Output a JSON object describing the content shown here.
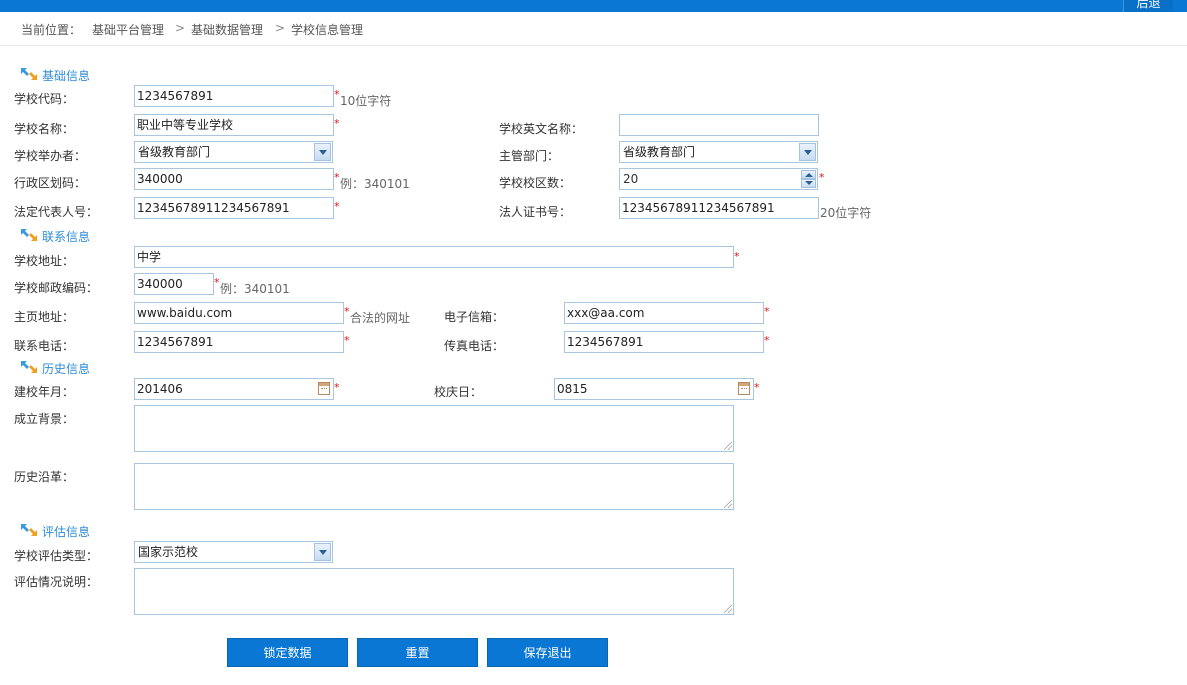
{
  "topbar": {
    "back_label": "后退"
  },
  "breadcrumb": {
    "prefix": "当前位置：",
    "items": [
      "基础平台管理",
      "基础数据管理",
      "学校信息管理"
    ],
    "separator": ">"
  },
  "sections": {
    "basic": "基础信息",
    "contact": "联系信息",
    "history": "历史信息",
    "evaluation": "评估信息"
  },
  "required_mark": "*",
  "basic": {
    "school_code": {
      "label": "学校代码：",
      "value": "1234567891",
      "hint": "10位字符"
    },
    "school_name": {
      "label": "学校名称：",
      "value": "职业中等专业学校"
    },
    "school_name_en": {
      "label": "学校英文名称：",
      "value": ""
    },
    "organizer": {
      "label": "学校举办者：",
      "value": "省级教育部门"
    },
    "department": {
      "label": "主管部门：",
      "value": "省级教育部门"
    },
    "region_code": {
      "label": "行政区划码：",
      "value": "340000",
      "hint": "例：340101"
    },
    "campus_count": {
      "label": "学校校区数：",
      "value": "20"
    },
    "legal_rep_id": {
      "label": "法定代表人号：",
      "value": "12345678911234567891"
    },
    "legal_cert_no": {
      "label": "法人证书号：",
      "value": "12345678911234567891",
      "hint": "20位字符"
    }
  },
  "contact": {
    "address": {
      "label": "学校地址：",
      "value": "中学"
    },
    "postcode": {
      "label": "学校邮政编码：",
      "value": "340000",
      "hint": "例：340101"
    },
    "homepage": {
      "label": "主页地址：",
      "value": "www.baidu.com",
      "hint": "合法的网址"
    },
    "email": {
      "label": "电子信箱：",
      "value": "xxx@aa.com"
    },
    "phone": {
      "label": "联系电话：",
      "value": "1234567891"
    },
    "fax": {
      "label": "传真电话：",
      "value": "1234567891"
    }
  },
  "history": {
    "founded": {
      "label": "建校年月：",
      "value": "201406"
    },
    "anniversary": {
      "label": "校庆日：",
      "value": "0815"
    },
    "background": {
      "label": "成立背景：",
      "value": ""
    },
    "evolution": {
      "label": "历史沿革：",
      "value": ""
    }
  },
  "evaluation": {
    "type": {
      "label": "学校评估类型：",
      "value": "国家示范校"
    },
    "description": {
      "label": "评估情况说明：",
      "value": ""
    }
  },
  "buttons": {
    "lock": "锁定数据",
    "reset": "重置",
    "save_exit": "保存退出"
  },
  "colors": {
    "accent": "#0a77d4",
    "section_title": "#2e8bd6",
    "required": "#e0141e",
    "input_border": "#a8c6e0"
  }
}
